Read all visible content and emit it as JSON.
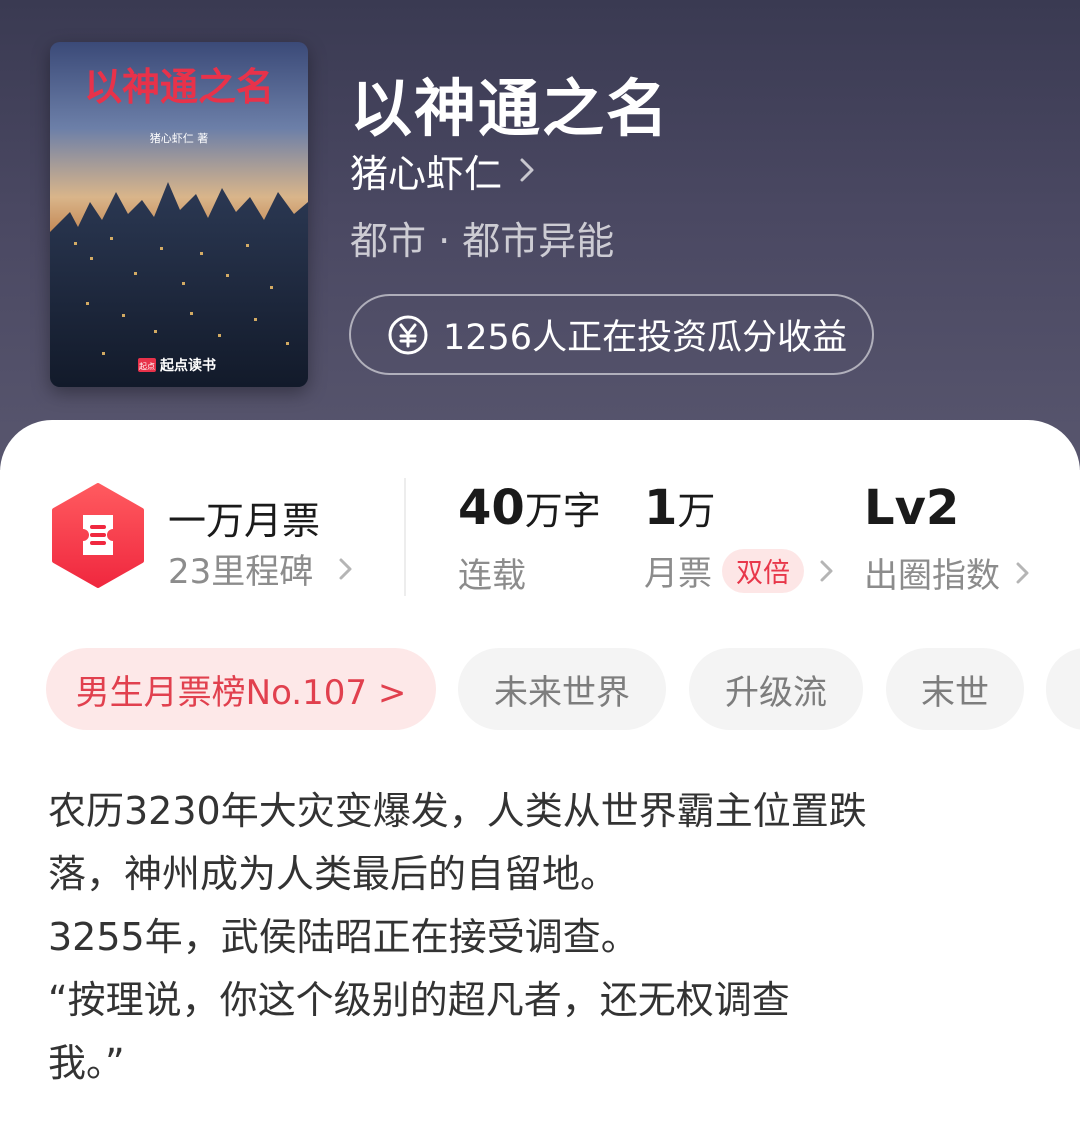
{
  "book": {
    "title": "以神通之名",
    "author": "猪心虾仁",
    "category": "都市 · 都市异能",
    "invest_text": "1256人正在投资瓜分收益",
    "cover": {
      "title": "以神通之名",
      "author": "猪心虾仁 著",
      "badge": "起点",
      "publisher": "起点读书"
    }
  },
  "stats": {
    "monthly_ticket": {
      "title": "一万月票",
      "subtitle": "23里程碑"
    },
    "words": {
      "value": "40",
      "unit": "万字",
      "label": "连载"
    },
    "tickets": {
      "value": "1",
      "unit": "万",
      "label": "月票",
      "badge": "双倍"
    },
    "index": {
      "value": "Lv2",
      "label": "出圈指数"
    }
  },
  "tags": [
    {
      "label": "男生月票榜No.107 >"
    },
    {
      "label": "未来世界"
    },
    {
      "label": "升级流"
    },
    {
      "label": "末世"
    }
  ],
  "synopsis": [
    "农历3230年大灾变爆发，人类从世界霸主位置跌",
    "落，神州成为人类最后的自留地。",
    "3255年，武侯陆昭正在接受调查。",
    "“按理说，你这个级别的超凡者，还无权调查",
    "我。”"
  ],
  "colors": {
    "header_bg": "#3f3d56",
    "accent_red": "#e8374a",
    "tag_bg": "#f4f4f4",
    "rank_tag_bg": "#fde8e8"
  }
}
